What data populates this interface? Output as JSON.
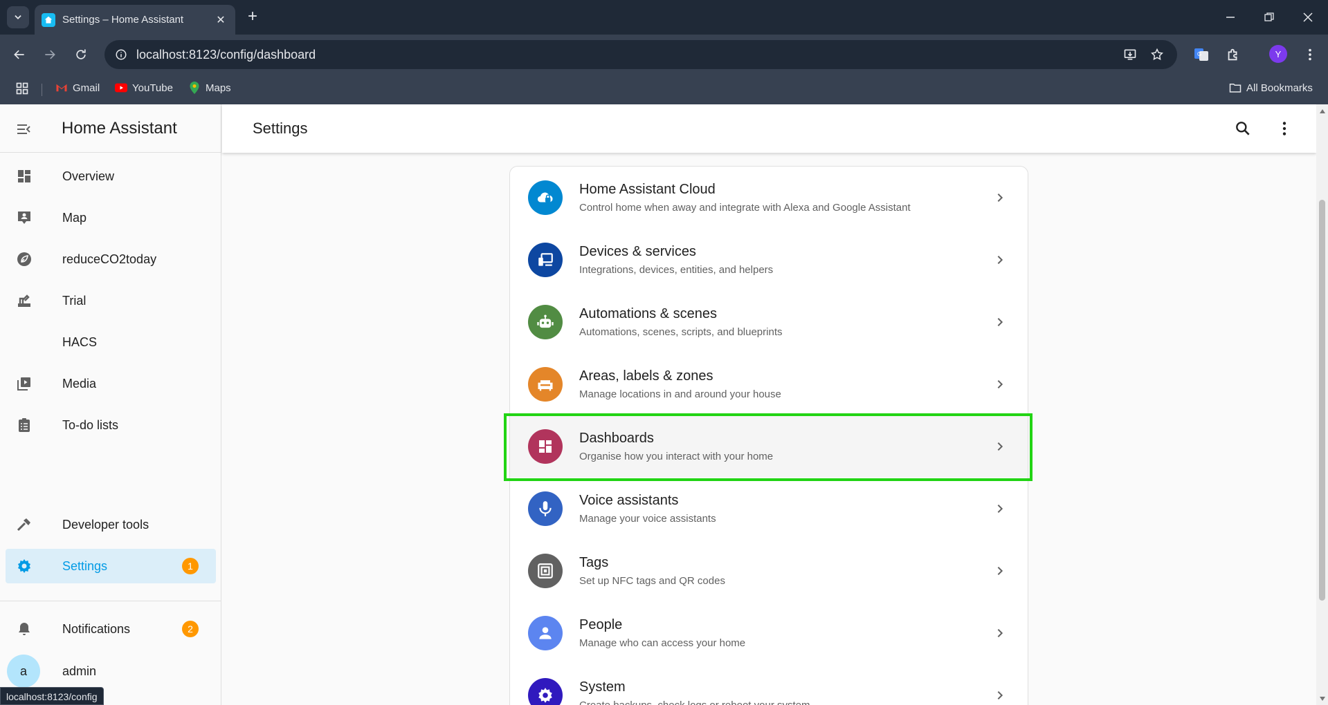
{
  "browser": {
    "tab_title": "Settings – Home Assistant",
    "url": "localhost:8123/config/dashboard",
    "profile_initial": "Y",
    "bookmarks": [
      "Gmail",
      "YouTube",
      "Maps"
    ],
    "all_bookmarks": "All Bookmarks",
    "status_url": "localhost:8123/config"
  },
  "sidebar": {
    "app_title": "Home Assistant",
    "items": [
      {
        "label": "Overview"
      },
      {
        "label": "Map"
      },
      {
        "label": "reduceCO2today"
      },
      {
        "label": "Trial"
      },
      {
        "label": "HACS"
      },
      {
        "label": "Media"
      },
      {
        "label": "To-do lists"
      }
    ],
    "developer_tools": "Developer tools",
    "settings": "Settings",
    "settings_badge": "1",
    "notifications": "Notifications",
    "notifications_badge": "2",
    "user_initial": "a",
    "user_name": "admin"
  },
  "main": {
    "page_title": "Settings",
    "rows": [
      {
        "title": "Home Assistant Cloud",
        "subtitle": "Control home when away and integrate with Alexa and Google Assistant",
        "color": "#0288d1"
      },
      {
        "title": "Devices & services",
        "subtitle": "Integrations, devices, entities, and helpers",
        "color": "#0d47a1"
      },
      {
        "title": "Automations & scenes",
        "subtitle": "Automations, scenes, scripts, and blueprints",
        "color": "#518c43"
      },
      {
        "title": "Areas, labels & zones",
        "subtitle": "Manage locations in and around your house",
        "color": "#e48629"
      },
      {
        "title": "Dashboards",
        "subtitle": "Organise how you interact with your home",
        "color": "#b1345c"
      },
      {
        "title": "Voice assistants",
        "subtitle": "Manage your voice assistants",
        "color": "#3263c3"
      },
      {
        "title": "Tags",
        "subtitle": "Set up NFC tags and QR codes",
        "color": "#616161"
      },
      {
        "title": "People",
        "subtitle": "Manage who can access your home",
        "color": "#5c85f0"
      },
      {
        "title": "System",
        "subtitle": "Create backups, check logs or reboot your system",
        "color": "#301ABE"
      }
    ]
  }
}
